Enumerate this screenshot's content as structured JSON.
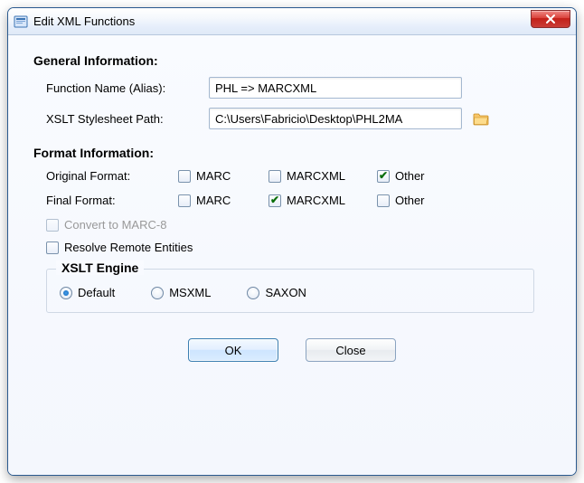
{
  "title": "Edit XML Functions",
  "sections": {
    "general": {
      "heading": "General Information:",
      "fn_label": "Function Name (Alias):",
      "fn_value": "PHL => MARCXML",
      "path_label": "XSLT Stylesheet Path:",
      "path_value": "C:\\Users\\Fabricio\\Desktop\\PHL2MA"
    },
    "format": {
      "heading": "Format Information:",
      "orig_label": "Original Format:",
      "final_label": "Final Format:",
      "opts": {
        "marc": "MARC",
        "marcxml": "MARCXML",
        "other": "Other"
      },
      "orig_checked": "other",
      "final_checked": "marcxml",
      "convert_marc8": "Convert to MARC-8",
      "resolve_entities": "Resolve Remote Entities"
    },
    "engine": {
      "heading": "XSLT Engine",
      "opts": {
        "default": "Default",
        "msxml": "MSXML",
        "saxon": "SAXON"
      },
      "selected": "default"
    }
  },
  "buttons": {
    "ok": "OK",
    "close": "Close"
  }
}
